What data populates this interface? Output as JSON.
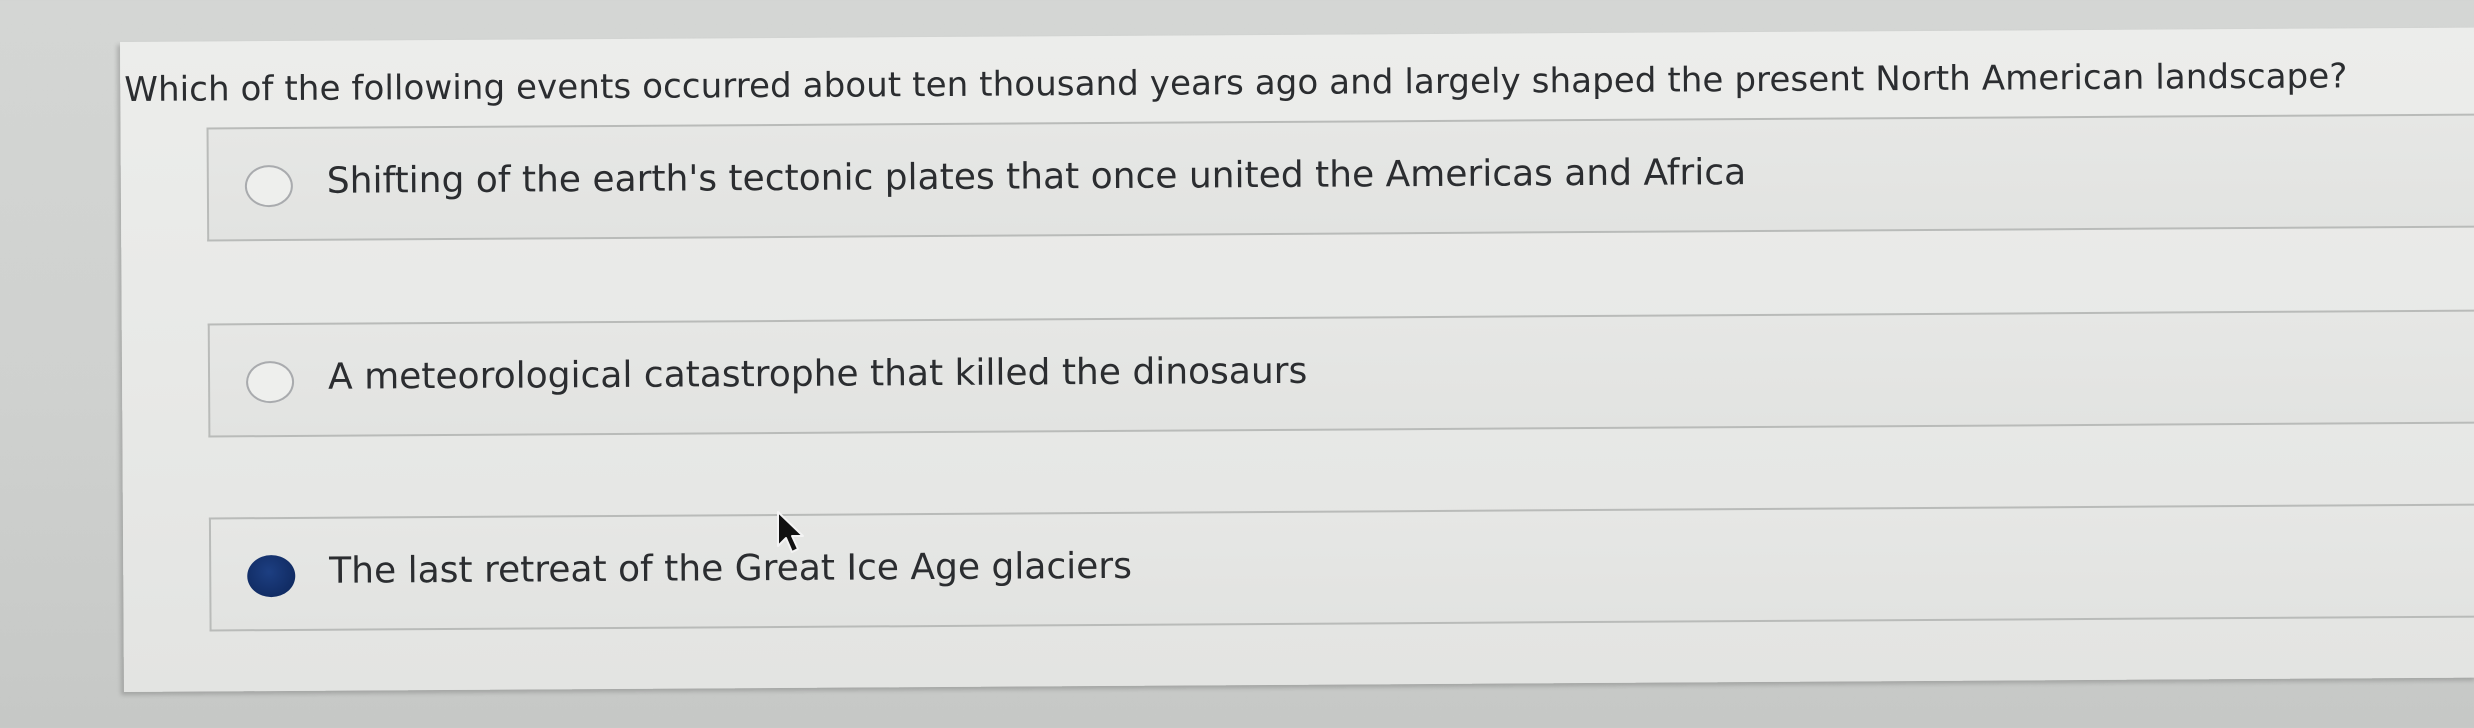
{
  "question": {
    "text": "Which of the following events occurred about ten thousand years ago and largely shaped the present North American landscape?"
  },
  "options": [
    {
      "label": "Shifting of the earth's tectonic plates that once united the Americas and Africa",
      "selected": false
    },
    {
      "label": "A meteorological catastrophe that killed the dinosaurs",
      "selected": false
    },
    {
      "label": "The last retreat of the Great Ice Age glaciers",
      "selected": true
    }
  ],
  "colors": {
    "selected_radio": "#112c64",
    "text": "#2b2d30",
    "card_background": "#e8e9e7",
    "page_background": "#d0d2d0"
  },
  "icons": {
    "pointer": "mouse-pointer-icon"
  }
}
